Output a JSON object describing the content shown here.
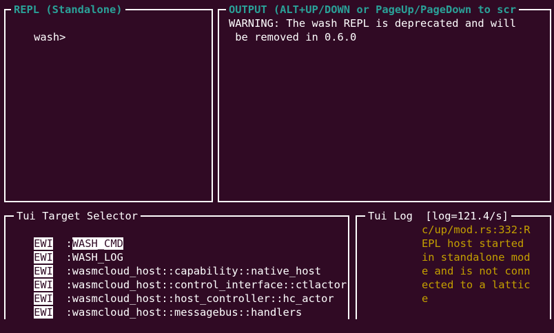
{
  "repl": {
    "title": "REPL (Standalone)",
    "prompt": "wash>",
    "input_value": ""
  },
  "output": {
    "title": "OUTPUT (ALT+UP/DOWN or PageUp/PageDown to scr",
    "lines": [
      "WARNING: The wash REPL is deprecated and will",
      " be removed in 0.6.0"
    ]
  },
  "target_selector": {
    "title": "Tui Target Selector",
    "items": [
      {
        "tag": "EWI",
        "name": ":WASH_CMD",
        "selected": true
      },
      {
        "tag": "EWI",
        "name": ":WASH_LOG",
        "selected": false
      },
      {
        "tag": "EWI",
        "name": ":wasmcloud_host::capability::native_host",
        "selected": false
      },
      {
        "tag": "EWI",
        "name": ":wasmcloud_host::control_interface::ctlactor",
        "selected": false
      },
      {
        "tag": "EWI",
        "name": ":wasmcloud_host::host_controller::hc_actor",
        "selected": false
      },
      {
        "tag": "EWI",
        "name": ":wasmcloud_host::messagebus::handlers",
        "selected": false
      }
    ]
  },
  "tui_log": {
    "title": "Tui Log",
    "rate": "[log=121.4/s]",
    "lines": [
      "c/up/mod.rs:332:R",
      "EPL host started",
      "in standalone mod",
      "e and is not conn",
      "ected to a lattic",
      "e"
    ]
  },
  "colors": {
    "background": "#300a24",
    "accent_title": "#2aa198",
    "log_text": "#c4a000",
    "border": "#ffffff"
  }
}
